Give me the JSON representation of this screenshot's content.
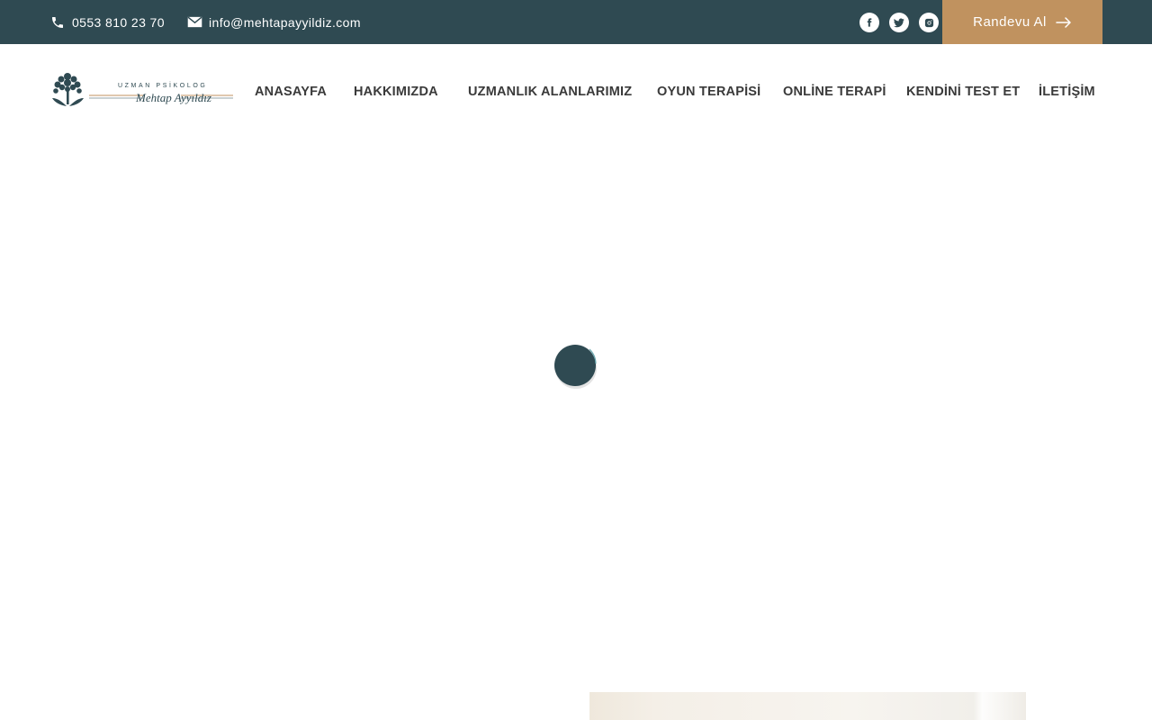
{
  "topbar": {
    "phone": "0553 810 23 70",
    "email": "info@mehtapayyildiz.com",
    "socials": [
      "facebook-icon",
      "twitter-icon",
      "instagram-icon"
    ],
    "cta_label": "Randevu Al",
    "background": "#2f4a52",
    "cta_color": "#c0925f"
  },
  "logo": {
    "line1": "UZMAN PSİKOLOG",
    "line2": "Mehtap Ayyıldız"
  },
  "nav": {
    "items": [
      "ANASAYFA",
      "HAKKIMIZDA",
      "UZMANLIK ALANLARIMIZ",
      "OYUN TERAPİSİ",
      "ONLİNE TERAPİ",
      "KENDİNİ TEST ET",
      "İLETİŞİM"
    ]
  },
  "loader": {
    "color": "#2f4a52"
  }
}
